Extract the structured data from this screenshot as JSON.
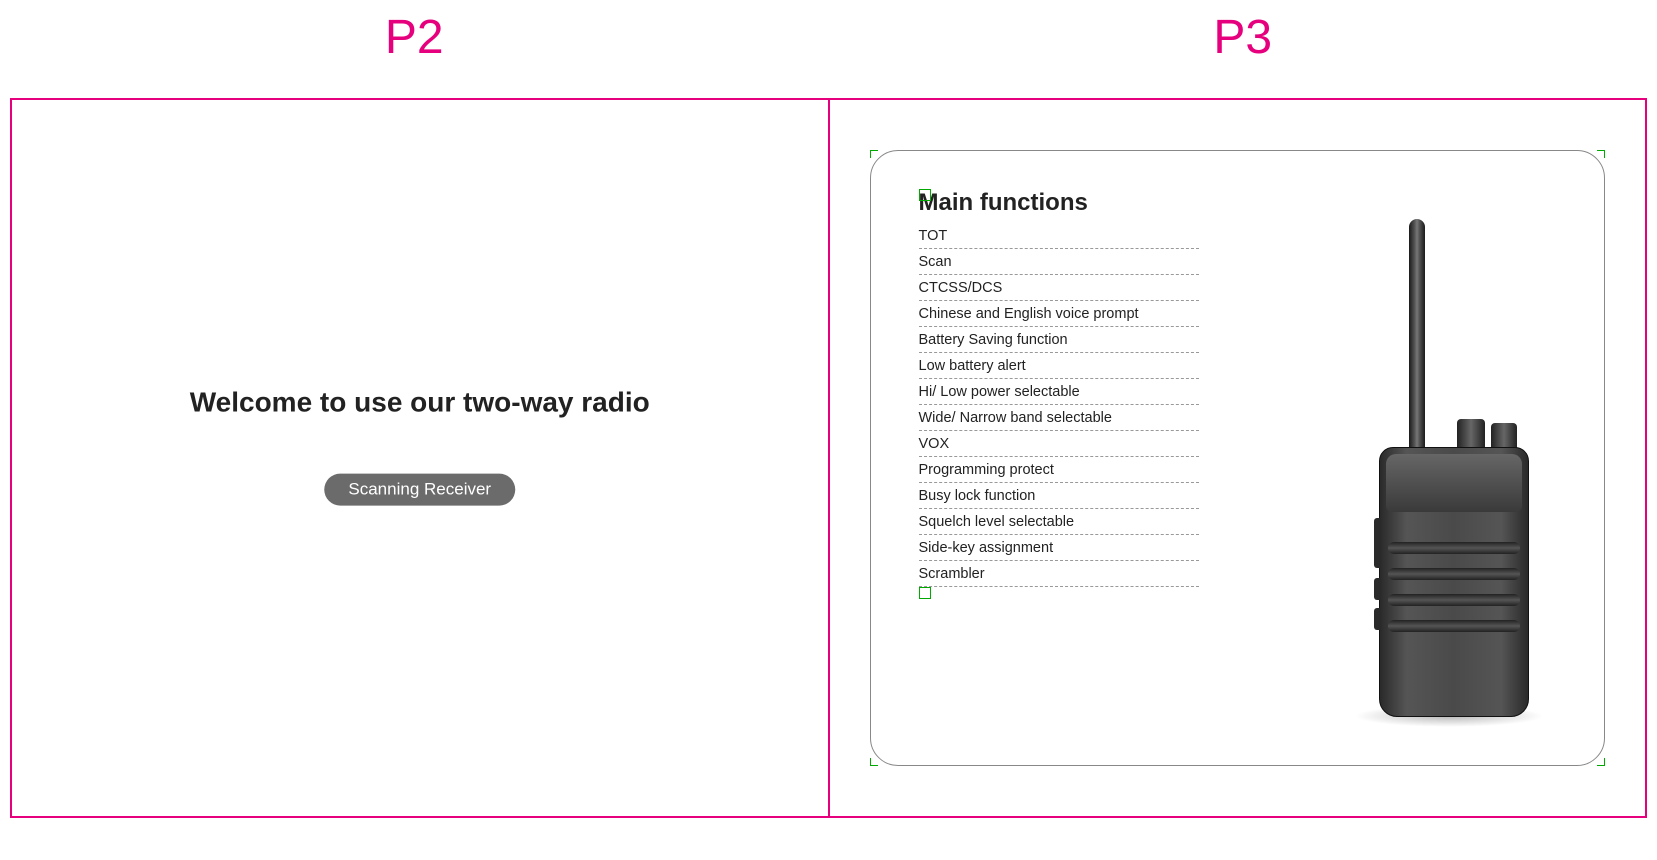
{
  "pages": {
    "left_label": "P2",
    "right_label": "P3"
  },
  "welcome": {
    "title": "Welcome to use our two-way radio",
    "subtitle": "Scanning Receiver"
  },
  "functions": {
    "title": "Main functions",
    "items": [
      "TOT",
      "Scan",
      "CTCSS/DCS",
      "Chinese and English voice prompt",
      "Battery Saving function",
      "Low battery alert",
      "Hi/ Low power selectable",
      "Wide/ Narrow band selectable",
      "VOX",
      "Programming protect",
      "Busy lock function",
      "Squelch level selectable",
      "Side-key assignment",
      "Scrambler"
    ]
  }
}
